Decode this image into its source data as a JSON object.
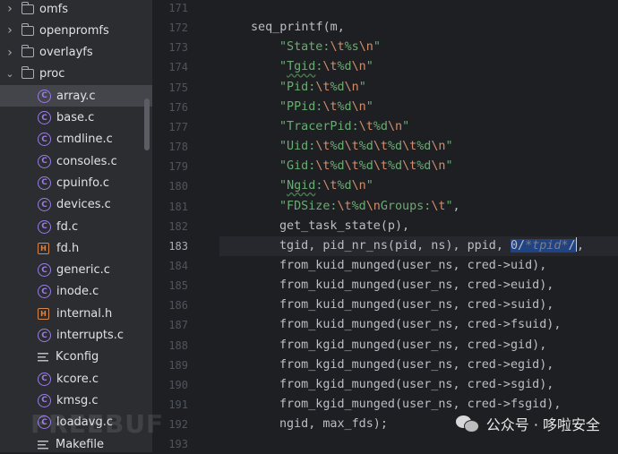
{
  "sidebar": {
    "items": [
      {
        "kind": "folder",
        "label": "omfs",
        "expanded": false
      },
      {
        "kind": "folder",
        "label": "openpromfs",
        "expanded": false
      },
      {
        "kind": "folder",
        "label": "overlayfs",
        "expanded": false
      },
      {
        "kind": "folder",
        "label": "proc",
        "expanded": true
      },
      {
        "kind": "c",
        "label": "array.c",
        "selected": true
      },
      {
        "kind": "c",
        "label": "base.c"
      },
      {
        "kind": "c",
        "label": "cmdline.c"
      },
      {
        "kind": "c",
        "label": "consoles.c"
      },
      {
        "kind": "c",
        "label": "cpuinfo.c"
      },
      {
        "kind": "c",
        "label": "devices.c"
      },
      {
        "kind": "c",
        "label": "fd.c"
      },
      {
        "kind": "h",
        "label": "fd.h"
      },
      {
        "kind": "c",
        "label": "generic.c"
      },
      {
        "kind": "c",
        "label": "inode.c"
      },
      {
        "kind": "h",
        "label": "internal.h"
      },
      {
        "kind": "c",
        "label": "interrupts.c"
      },
      {
        "kind": "text",
        "label": "Kconfig"
      },
      {
        "kind": "c",
        "label": "kcore.c"
      },
      {
        "kind": "c",
        "label": "kmsg.c"
      },
      {
        "kind": "c",
        "label": "loadavg.c"
      },
      {
        "kind": "text",
        "label": "Makefile"
      }
    ]
  },
  "editor": {
    "current_line": 183,
    "lines": [
      {
        "n": 171,
        "indent": 0,
        "parts": []
      },
      {
        "n": 172,
        "indent": 1,
        "parts": [
          {
            "t": "p",
            "v": "seq_printf(m,"
          }
        ]
      },
      {
        "n": 173,
        "indent": 2,
        "parts": [
          {
            "t": "s",
            "v": "\"State:"
          },
          {
            "t": "e",
            "v": "\\t"
          },
          {
            "t": "s",
            "v": "%s"
          },
          {
            "t": "e",
            "v": "\\n"
          },
          {
            "t": "s",
            "v": "\""
          }
        ]
      },
      {
        "n": 174,
        "indent": 2,
        "parts": [
          {
            "t": "s",
            "v": "\""
          },
          {
            "t": "sq",
            "v": "Tgid"
          },
          {
            "t": "s",
            "v": ":"
          },
          {
            "t": "e",
            "v": "\\t"
          },
          {
            "t": "s",
            "v": "%d"
          },
          {
            "t": "e",
            "v": "\\n"
          },
          {
            "t": "s",
            "v": "\""
          }
        ]
      },
      {
        "n": 175,
        "indent": 2,
        "parts": [
          {
            "t": "s",
            "v": "\"Pid:"
          },
          {
            "t": "e",
            "v": "\\t"
          },
          {
            "t": "s",
            "v": "%d"
          },
          {
            "t": "e",
            "v": "\\n"
          },
          {
            "t": "s",
            "v": "\""
          }
        ]
      },
      {
        "n": 176,
        "indent": 2,
        "parts": [
          {
            "t": "s",
            "v": "\"PPid:"
          },
          {
            "t": "e",
            "v": "\\t"
          },
          {
            "t": "s",
            "v": "%d"
          },
          {
            "t": "e",
            "v": "\\n"
          },
          {
            "t": "s",
            "v": "\""
          }
        ]
      },
      {
        "n": 177,
        "indent": 2,
        "parts": [
          {
            "t": "s",
            "v": "\"TracerPid:"
          },
          {
            "t": "e",
            "v": "\\t"
          },
          {
            "t": "s",
            "v": "%d"
          },
          {
            "t": "e",
            "v": "\\n"
          },
          {
            "t": "s",
            "v": "\""
          }
        ]
      },
      {
        "n": 178,
        "indent": 2,
        "parts": [
          {
            "t": "s",
            "v": "\"Uid:"
          },
          {
            "t": "e",
            "v": "\\t"
          },
          {
            "t": "s",
            "v": "%d"
          },
          {
            "t": "e",
            "v": "\\t"
          },
          {
            "t": "s",
            "v": "%d"
          },
          {
            "t": "e",
            "v": "\\t"
          },
          {
            "t": "s",
            "v": "%d"
          },
          {
            "t": "e",
            "v": "\\t"
          },
          {
            "t": "s",
            "v": "%d"
          },
          {
            "t": "e",
            "v": "\\n"
          },
          {
            "t": "s",
            "v": "\""
          }
        ]
      },
      {
        "n": 179,
        "indent": 2,
        "parts": [
          {
            "t": "s",
            "v": "\"Gid:"
          },
          {
            "t": "e",
            "v": "\\t"
          },
          {
            "t": "s",
            "v": "%d"
          },
          {
            "t": "e",
            "v": "\\t"
          },
          {
            "t": "s",
            "v": "%d"
          },
          {
            "t": "e",
            "v": "\\t"
          },
          {
            "t": "s",
            "v": "%d"
          },
          {
            "t": "e",
            "v": "\\t"
          },
          {
            "t": "s",
            "v": "%d"
          },
          {
            "t": "e",
            "v": "\\n"
          },
          {
            "t": "s",
            "v": "\""
          }
        ]
      },
      {
        "n": 180,
        "indent": 2,
        "parts": [
          {
            "t": "s",
            "v": "\""
          },
          {
            "t": "sq",
            "v": "Ngid"
          },
          {
            "t": "s",
            "v": ":"
          },
          {
            "t": "e",
            "v": "\\t"
          },
          {
            "t": "s",
            "v": "%d"
          },
          {
            "t": "e",
            "v": "\\n"
          },
          {
            "t": "s",
            "v": "\""
          }
        ]
      },
      {
        "n": 181,
        "indent": 2,
        "parts": [
          {
            "t": "s",
            "v": "\"FDSize:"
          },
          {
            "t": "e",
            "v": "\\t"
          },
          {
            "t": "s",
            "v": "%d"
          },
          {
            "t": "e",
            "v": "\\n"
          },
          {
            "t": "s",
            "v": "Groups:"
          },
          {
            "t": "e",
            "v": "\\t"
          },
          {
            "t": "s",
            "v": "\""
          },
          {
            "t": "p",
            "v": ","
          }
        ]
      },
      {
        "n": 182,
        "indent": 2,
        "parts": [
          {
            "t": "p",
            "v": "get_task_state(p),"
          }
        ]
      },
      {
        "n": 183,
        "indent": 2,
        "parts": [
          {
            "t": "p",
            "v": "tgid, pid_nr_ns(pid, ns), ppid, "
          },
          {
            "t": "sel",
            "v": "0/"
          },
          {
            "t": "selc",
            "v": "*tpid*"
          },
          {
            "t": "sel",
            "v": "/"
          },
          {
            "t": "caret",
            "v": ""
          },
          {
            "t": "p",
            "v": ","
          }
        ]
      },
      {
        "n": 184,
        "indent": 2,
        "parts": [
          {
            "t": "p",
            "v": "from_kuid_munged(user_ns, cred->uid),"
          }
        ]
      },
      {
        "n": 185,
        "indent": 2,
        "parts": [
          {
            "t": "p",
            "v": "from_kuid_munged(user_ns, cred->euid),"
          }
        ]
      },
      {
        "n": 186,
        "indent": 2,
        "parts": [
          {
            "t": "p",
            "v": "from_kuid_munged(user_ns, cred->suid),"
          }
        ]
      },
      {
        "n": 187,
        "indent": 2,
        "parts": [
          {
            "t": "p",
            "v": "from_kuid_munged(user_ns, cred->fsuid),"
          }
        ]
      },
      {
        "n": 188,
        "indent": 2,
        "parts": [
          {
            "t": "p",
            "v": "from_kgid_munged(user_ns, cred->gid),"
          }
        ]
      },
      {
        "n": 189,
        "indent": 2,
        "parts": [
          {
            "t": "p",
            "v": "from_kgid_munged(user_ns, cred->egid),"
          }
        ]
      },
      {
        "n": 190,
        "indent": 2,
        "parts": [
          {
            "t": "p",
            "v": "from_kgid_munged(user_ns, cred->sgid),"
          }
        ]
      },
      {
        "n": 191,
        "indent": 2,
        "parts": [
          {
            "t": "p",
            "v": "from_kgid_munged(user_ns, cred->fsgid),"
          }
        ]
      },
      {
        "n": 192,
        "indent": 2,
        "parts": [
          {
            "t": "p",
            "v": "ngid, max_fds);"
          }
        ]
      },
      {
        "n": 193,
        "indent": 0,
        "parts": []
      }
    ]
  },
  "colors": {
    "string": "#6aab73",
    "escape": "#cf8e6d",
    "selection": "#214283",
    "sidebar_bg": "#2b2d30",
    "editor_bg": "#1e1f22"
  },
  "watermark": {
    "text": "公众号 · 哆啦安全",
    "faint": "FREEBUF"
  }
}
